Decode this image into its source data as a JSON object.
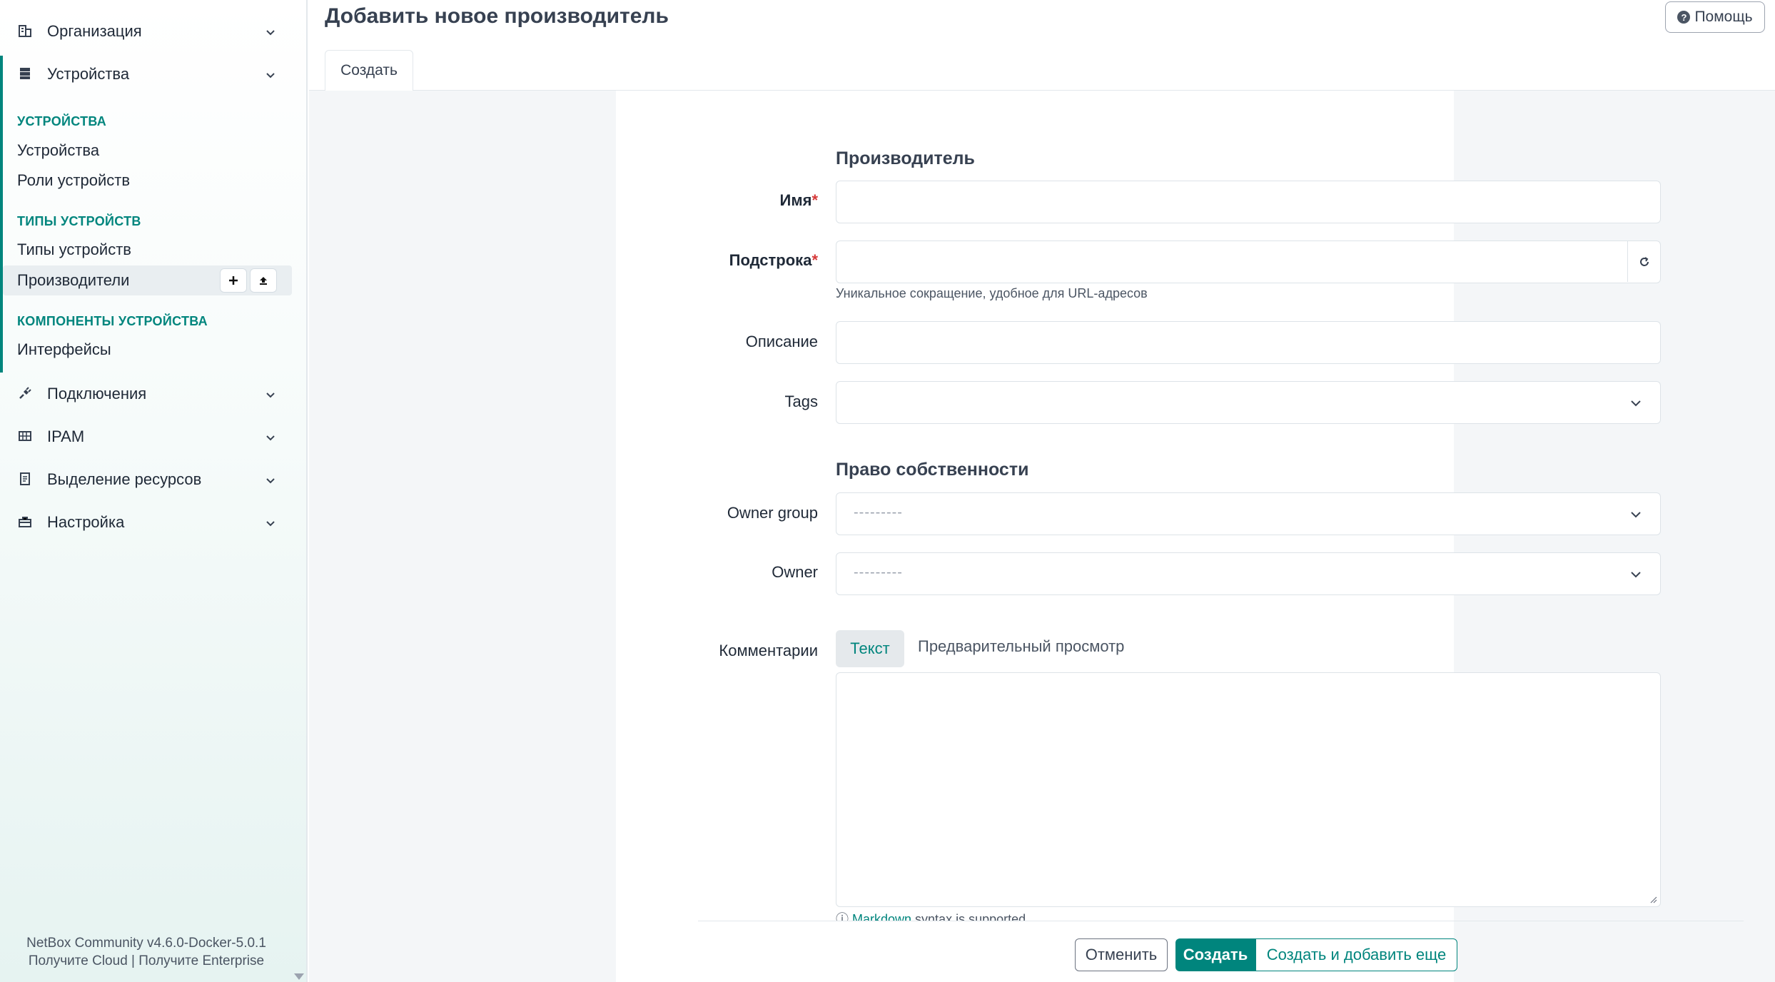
{
  "sidebar": {
    "groups_top": [
      {
        "label": "Организация",
        "icon": "organization-icon"
      },
      {
        "label": "Устройства",
        "icon": "devices-icon"
      }
    ],
    "sections": [
      {
        "heading": "УСТРОЙСТВА",
        "items": [
          "Устройства",
          "Роли устройств"
        ]
      },
      {
        "heading": "ТИПЫ УСТРОЙСТВ",
        "items": [
          "Типы устройств",
          "Производители"
        ]
      },
      {
        "heading": "КОМПОНЕНТЫ УСТРОЙСТВА",
        "items": [
          "Интерфейсы"
        ]
      }
    ],
    "active_item": "Производители",
    "groups_bottom": [
      {
        "label": "Подключения",
        "icon": "connections-icon"
      },
      {
        "label": "IPAM",
        "icon": "ipam-icon"
      },
      {
        "label": "Выделение ресурсов",
        "icon": "provisioning-icon"
      },
      {
        "label": "Настройка",
        "icon": "customization-icon"
      }
    ],
    "footer": {
      "version": "NetBox Community v4.6.0-Docker-5.0.1",
      "cloud_link": "Получите Cloud",
      "separator": "|",
      "enterprise_link": "Получите Enterprise"
    }
  },
  "header": {
    "title": "Добавить новое производитель",
    "help_button": "Помощь"
  },
  "tabs": [
    {
      "label": "Создать",
      "active": true
    }
  ],
  "form": {
    "section_manufacturer": "Производитель",
    "name_label": "Имя",
    "slug_label": "Подстрока",
    "slug_help": "Уникальное сокращение, удобное для URL-адресов",
    "description_label": "Описание",
    "tags_label": "Tags",
    "section_ownership": "Право собственности",
    "owner_group_label": "Owner group",
    "owner_group_value": "---------",
    "owner_label": "Owner",
    "owner_value": "---------",
    "comments_label": "Комментарии",
    "comments_tab_text": "Текст",
    "comments_tab_preview": "Предварительный просмотр",
    "markdown_link": "Markdown",
    "markdown_note": " syntax is supported",
    "required_mark": "*"
  },
  "actions": {
    "cancel": "Отменить",
    "create": "Создать",
    "create_and_add": "Создать и добавить еще"
  },
  "colors": {
    "accent": "#00857d",
    "required": "#d63939"
  }
}
